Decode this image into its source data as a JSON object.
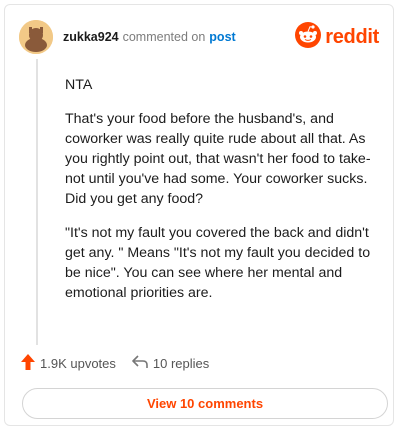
{
  "comment": {
    "username": "zukka924",
    "commented_text": "commented on",
    "post_link": "post",
    "brand": "reddit",
    "paragraphs": [
      "NTA",
      "That's your food before the husband's, and coworker was really quite rude about all that. As you rightly point out, that wasn't her food to take- not until you've had some. Your coworker sucks. Did you get any food?",
      "\"It's not my fault you covered the back and didn't get any. \" Means \"It's not my fault you decided to be nice\". You can see where her mental and emotional priorities are."
    ]
  },
  "actions": {
    "upvotes": "1.9K upvotes",
    "replies": "10 replies"
  },
  "view_button": "View 10 comments",
  "colors": {
    "accent": "#ff4500",
    "link": "#0079d3",
    "muted": "#7c7c7c"
  },
  "icons": [
    "avatar",
    "reddit-logo-icon",
    "upvote-arrow-icon",
    "reply-icon"
  ]
}
